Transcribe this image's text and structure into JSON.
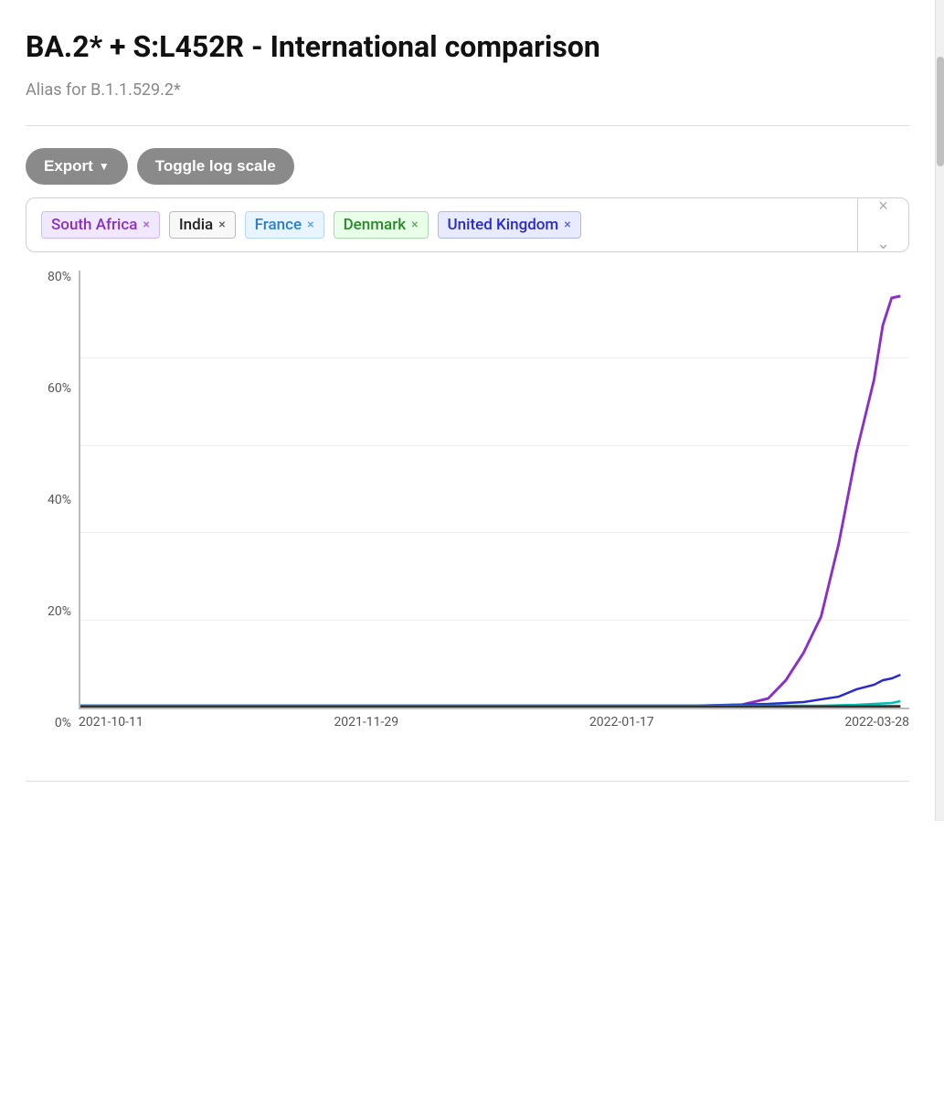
{
  "page": {
    "title": "BA.2* + S:L452R - International comparison",
    "subtitle": "Alias for B.1.1.529.2*"
  },
  "toolbar": {
    "export_label": "Export",
    "toggle_log_scale_label": "Toggle log scale"
  },
  "countries": [
    {
      "id": "south-africa",
      "label": "South Africa",
      "tag_class": "tag-south-africa"
    },
    {
      "id": "india",
      "label": "India",
      "tag_class": "tag-india"
    },
    {
      "id": "france",
      "label": "France",
      "tag_class": "tag-france"
    },
    {
      "id": "denmark",
      "label": "Denmark",
      "tag_class": "tag-denmark"
    },
    {
      "id": "uk",
      "label": "United Kingdom",
      "tag_class": "tag-uk"
    }
  ],
  "chart": {
    "y_labels": [
      "0%",
      "20%",
      "40%",
      "60%",
      "80%"
    ],
    "x_labels": [
      "2021-10-11",
      "2021-11-29",
      "2022-01-17",
      "2022-03-28"
    ],
    "colors": {
      "south_africa": "#8b2fc9",
      "india": "#222222",
      "france": "#2a7fcc",
      "denmark": "#2a8a2a",
      "uk": "#2a2acc",
      "teal": "#00c0b0"
    }
  },
  "icons": {
    "chevron_down": "▼",
    "close": "×",
    "expand": "⌄"
  }
}
